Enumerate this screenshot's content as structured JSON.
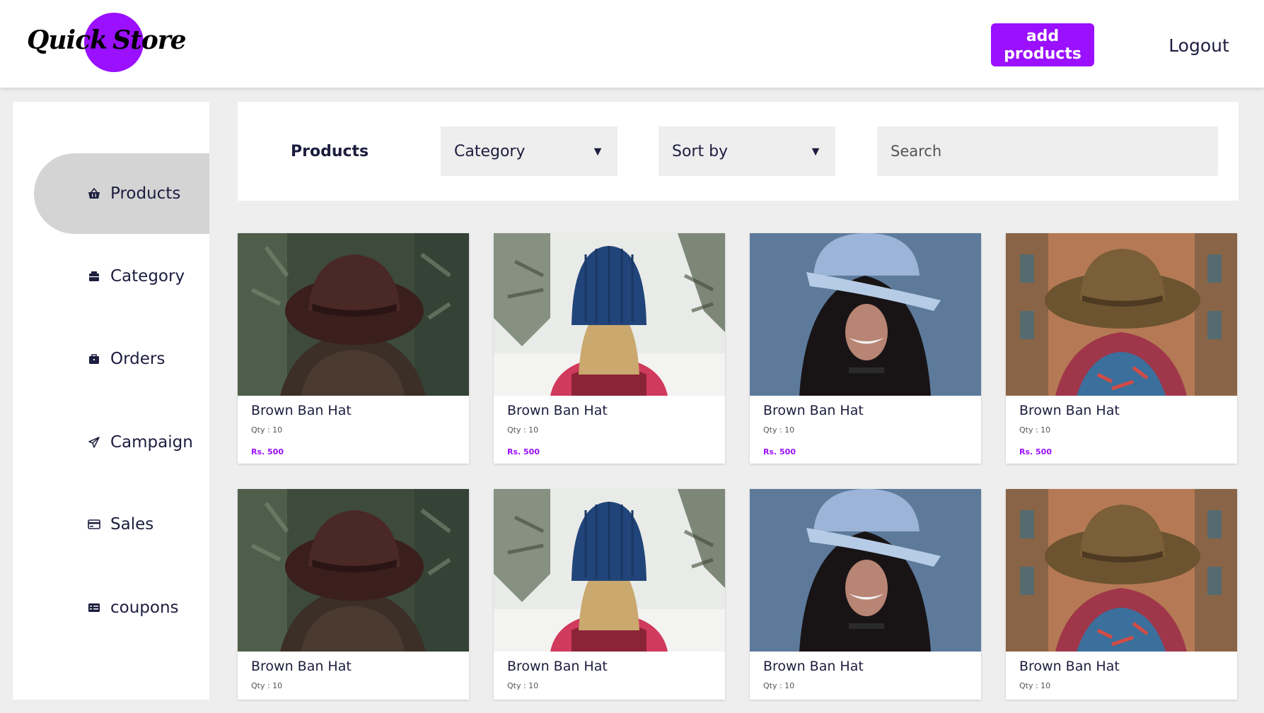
{
  "brand": {
    "word1": "Quick",
    "word2": "Store"
  },
  "header": {
    "add_button": "add products",
    "logout": "Logout"
  },
  "sidebar": {
    "items": [
      {
        "label": "Products",
        "icon": "basket-icon",
        "active": true
      },
      {
        "label": "Category",
        "icon": "category-icon",
        "active": false
      },
      {
        "label": "Orders",
        "icon": "briefcase-icon",
        "active": false
      },
      {
        "label": "Campaign",
        "icon": "paper-plane-icon",
        "active": false
      },
      {
        "label": "Sales",
        "icon": "card-icon",
        "active": false
      },
      {
        "label": "coupons",
        "icon": "coupon-icon",
        "active": false
      }
    ]
  },
  "toolbar": {
    "title": "Products",
    "category_select": "Category",
    "sort_select": "Sort by",
    "search_placeholder": "Search"
  },
  "products": [
    {
      "name": "Brown Ban Hat",
      "qty": "Qty : 10",
      "price": "Rs. 500",
      "image": "brown-fedora"
    },
    {
      "name": "Brown Ban Hat",
      "qty": "Qty : 10",
      "price": "Rs. 500",
      "image": "blue-beanie"
    },
    {
      "name": "Brown Ban Hat",
      "qty": "Qty : 10",
      "price": "Rs. 500",
      "image": "blue-cap"
    },
    {
      "name": "Brown Ban Hat",
      "qty": "Qty : 10",
      "price": "Rs. 500",
      "image": "cowboy-hat"
    },
    {
      "name": "Brown Ban Hat",
      "qty": "Qty : 10",
      "image": "brown-fedora"
    },
    {
      "name": "Brown Ban Hat",
      "qty": "Qty : 10",
      "image": "blue-beanie"
    },
    {
      "name": "Brown Ban Hat",
      "qty": "Qty : 10",
      "image": "blue-cap"
    },
    {
      "name": "Brown Ban Hat",
      "qty": "Qty : 10",
      "image": "cowboy-hat"
    }
  ],
  "colors": {
    "accent": "#9a10ff",
    "text": "#1d1d3f",
    "active_nav": "#d4d4d4",
    "background": "#eeeeee"
  }
}
